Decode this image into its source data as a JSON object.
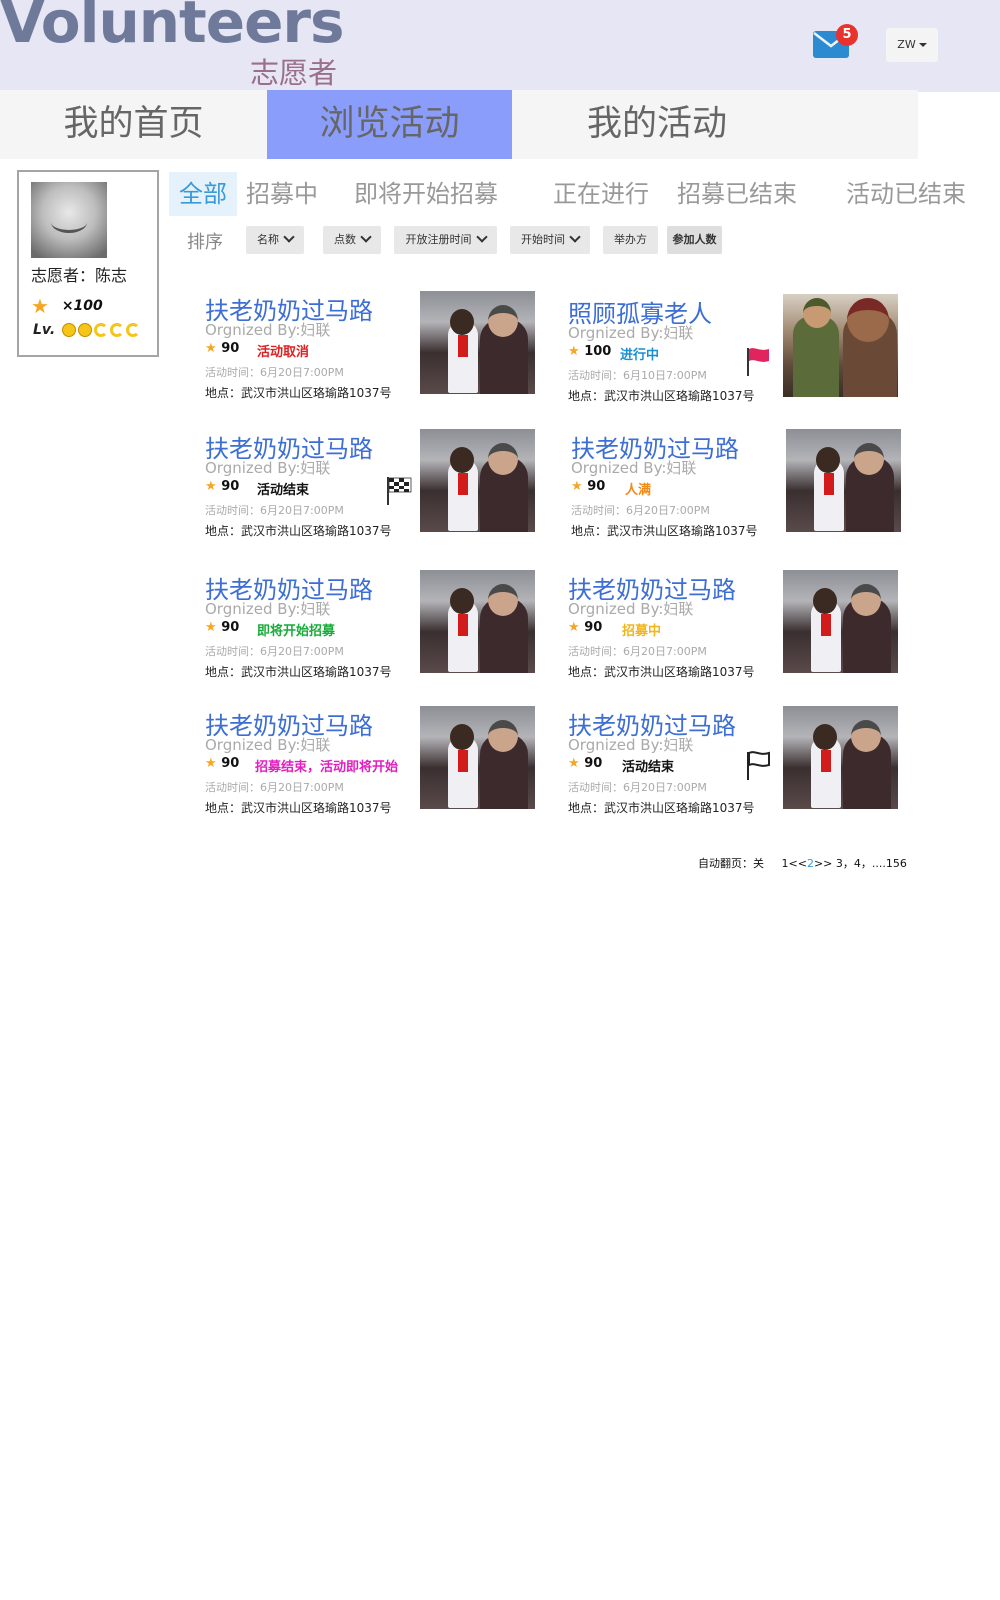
{
  "header": {
    "logo_en": "Volunteers",
    "logo_cn": "志愿者",
    "mail_count": "5",
    "user": "ZW"
  },
  "nav": {
    "home": "我的首页",
    "browse": "浏览活动",
    "mine": "我的活动"
  },
  "profile": {
    "name": "志愿者：陈志",
    "points": "×100",
    "level_label": "Lv."
  },
  "filters": [
    "全部",
    "招募中",
    "即将开始招募",
    "正在进行",
    "招募已结束",
    "活动已结束"
  ],
  "sort": {
    "label": "排序",
    "buttons": [
      "名称",
      "点数",
      "开放注册时间",
      "开始时间",
      "举办方",
      "参加人数"
    ]
  },
  "activities": [
    {
      "title": "扶老奶奶过马路",
      "org": "Orgnized By:妇联",
      "score": "90",
      "status": "活动取消",
      "status_color": "#e02020",
      "time": "活动时间：6月20日7:00PM",
      "location": "地点：武汉市洪山区珞瑜路1037号"
    },
    {
      "title": "照顾孤寡老人",
      "org": "Orgnized By:妇联",
      "score": "100",
      "status": "进行中",
      "status_color": "#1a8fd6",
      "time": "活动时间：6月10日7:00PM",
      "location": "地点：武汉市洪山区珞瑜路1037号"
    },
    {
      "title": "扶老奶奶过马路",
      "org": "Orgnized By:妇联",
      "score": "90",
      "status": "活动结束",
      "status_color": "#111111",
      "time": "活动时间：6月20日7:00PM",
      "location": "地点：武汉市洪山区珞瑜路1037号"
    },
    {
      "title": "扶老奶奶过马路",
      "org": "Orgnized By:妇联",
      "score": "90",
      "status": "人满",
      "status_color": "#f08a1a",
      "time": "活动时间：6月20日7:00PM",
      "location": "地点：武汉市洪山区珞瑜路1037号"
    },
    {
      "title": "扶老奶奶过马路",
      "org": "Orgnized By:妇联",
      "score": "90",
      "status": "即将开始招募",
      "status_color": "#1aaa3a",
      "time": "活动时间：6月20日7:00PM",
      "location": "地点：武汉市洪山区珞瑜路1037号"
    },
    {
      "title": "扶老奶奶过马路",
      "org": "Orgnized By:妇联",
      "score": "90",
      "status": "招募中",
      "status_color": "#f2b51a",
      "time": "活动时间：6月20日7:00PM",
      "location": "地点：武汉市洪山区珞瑜路1037号"
    },
    {
      "title": "扶老奶奶过马路",
      "org": "Orgnized By:妇联",
      "score": "90",
      "status": "招募结束，活动即将开始",
      "status_color": "#e21fc0",
      "time": "活动时间：6月20日7:00PM",
      "location": "地点：武汉市洪山区珞瑜路1037号"
    },
    {
      "title": "扶老奶奶过马路",
      "org": "Orgnized By:妇联",
      "score": "90",
      "status": "活动结束",
      "status_color": "#111111",
      "time": "活动时间：6月20日7:00PM",
      "location": "地点：武汉市洪山区珞瑜路1037号"
    }
  ],
  "pager": {
    "auto": "自动翻页：关",
    "prefix": "1<<",
    "current": "2",
    "suffix": ">> 3，4，....156"
  },
  "icons": [
    "mail-icon",
    "caret-down-icon",
    "star-icon",
    "sun-level-icon",
    "moon-level-icon",
    "chevron-down-icon",
    "red-flag-icon",
    "checkered-flag-icon",
    "black-flag-icon"
  ],
  "colors": {
    "accent": "#8b9dfb",
    "title_blue": "#3d6ed6",
    "star": "#f5a623"
  }
}
